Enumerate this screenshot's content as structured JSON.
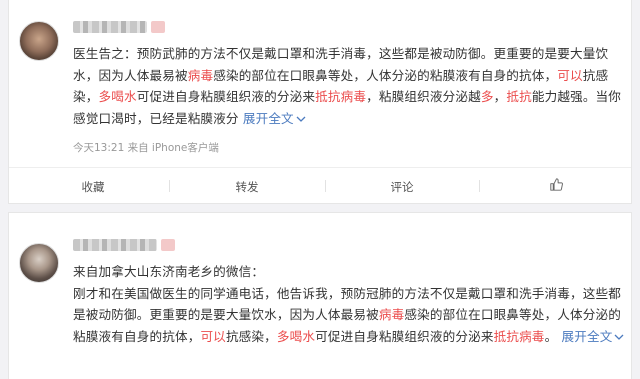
{
  "posts": [
    {
      "segments": [
        {
          "text": "医生告之：预防武肺的方法不仅是戴口罩和洗手消毒，这些都是被动防御。更重要的是要大量饮水，因为人体最易被",
          "style": "normal"
        },
        {
          "text": "病毒",
          "style": "red"
        },
        {
          "text": "感染的部位在口眼鼻等处，人体分泌的粘膜液有自身的抗体，",
          "style": "normal"
        },
        {
          "text": "可以",
          "style": "red"
        },
        {
          "text": "抗感染，",
          "style": "normal"
        },
        {
          "text": "多喝水",
          "style": "red"
        },
        {
          "text": "可促进自身粘膜组织液的分泌来",
          "style": "normal"
        },
        {
          "text": "抵抗病毒",
          "style": "red"
        },
        {
          "text": "，粘膜组织液分泌越",
          "style": "normal"
        },
        {
          "text": "多",
          "style": "red"
        },
        {
          "text": "，",
          "style": "normal"
        },
        {
          "text": "抵抗",
          "style": "red"
        },
        {
          "text": "能力越强。当你感觉口渴时，已经是粘膜液分",
          "style": "normal"
        }
      ],
      "expand_label": "展开全文",
      "expand_icon": "chevron-down-icon",
      "meta": "今天13:21 来自 iPhone客户端",
      "actions": {
        "collect": "收藏",
        "repost": "转发",
        "comment": "评论"
      }
    },
    {
      "segments": [
        {
          "text": "来自加拿大山东济南老乡的微信：",
          "style": "normal",
          "break_after": true
        },
        {
          "text": "刚才和在美国做医生的同学通电话，他告诉我，预防冠肺的方法不仅是戴口罩和洗手消毒，这些都是被动防御。更重要的是要大量饮水，因为人体最易被",
          "style": "normal"
        },
        {
          "text": "病毒",
          "style": "red"
        },
        {
          "text": "感染的部位在口眼鼻等处，人体分泌的粘膜液有自身的抗体，",
          "style": "normal"
        },
        {
          "text": "可以",
          "style": "red"
        },
        {
          "text": "抗感染，",
          "style": "normal"
        },
        {
          "text": "多喝水",
          "style": "red"
        },
        {
          "text": "可促进自身粘膜组织液的分泌来",
          "style": "normal"
        },
        {
          "text": "抵抗病毒",
          "style": "red"
        },
        {
          "text": "。",
          "style": "normal"
        }
      ],
      "expand_label": "展开全文",
      "expand_icon": "chevron-down-icon"
    }
  ],
  "colors": {
    "red": "#eb4d4d",
    "link": "#4c7bbf",
    "meta": "#999999"
  },
  "icons": {
    "like": "thumbs-up-icon"
  }
}
